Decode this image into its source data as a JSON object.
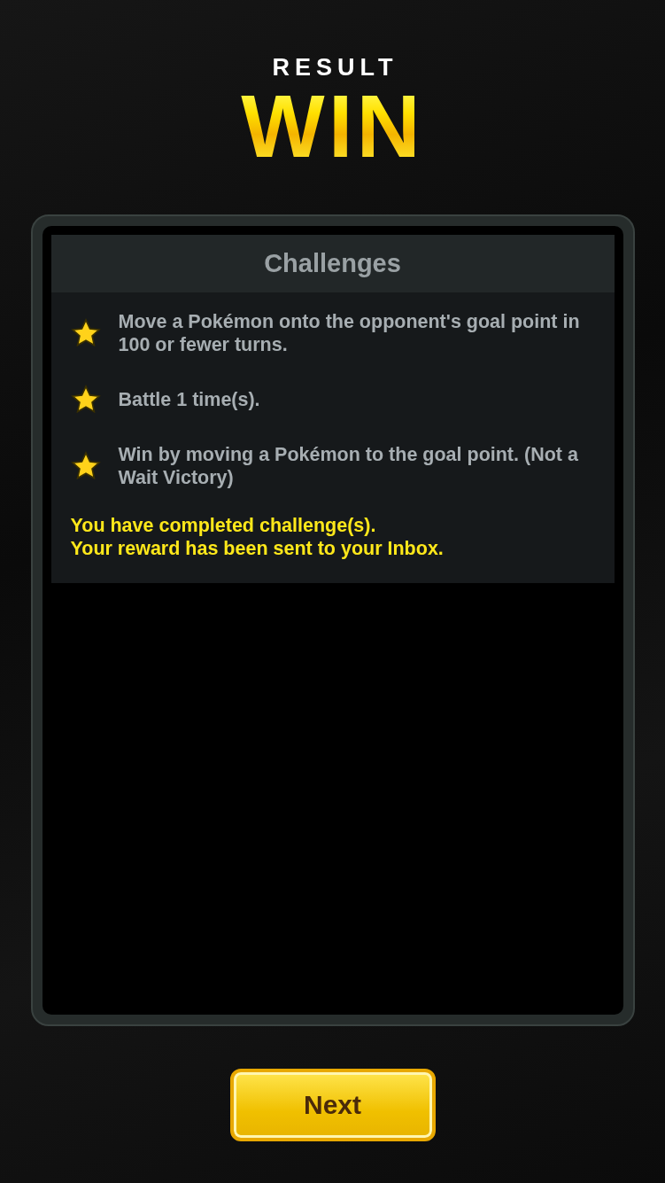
{
  "result_label": "RESULT",
  "outcome": "WIN",
  "challenges": {
    "title": "Challenges",
    "items": [
      {
        "text": "Move a Pokémon onto the opponent's goal point in 100 or fewer turns.",
        "completed": true
      },
      {
        "text": "Battle 1 time(s).",
        "completed": true
      },
      {
        "text": "Win by moving a Pokémon to the goal point. (Not a Wait Victory)",
        "completed": true
      }
    ],
    "message": [
      "You have completed challenge(s).",
      "Your reward has been sent to your Inbox."
    ]
  },
  "next_button": "Next"
}
